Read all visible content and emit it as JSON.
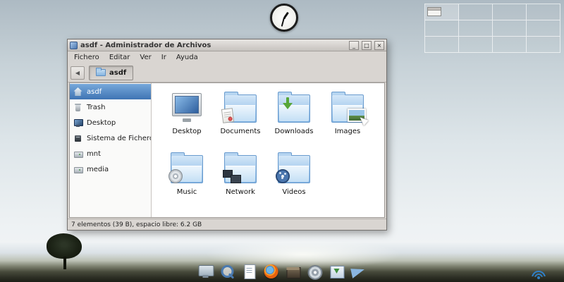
{
  "desktop": {
    "clock_widget": "analog-clock",
    "pager": {
      "columns": 4,
      "rows": 3,
      "active_workspace": 1
    }
  },
  "window": {
    "title": "asdf - Administrador de Archivos",
    "buttons": {
      "minimize": "_",
      "maximize": "□",
      "close": "×"
    },
    "menu": [
      {
        "label": "Fichero"
      },
      {
        "label": "Editar"
      },
      {
        "label": "Ver"
      },
      {
        "label": "Ir"
      },
      {
        "label": "Ayuda"
      }
    ],
    "toolbar": {
      "back_icon": "◀",
      "path_button": {
        "label": "asdf"
      }
    },
    "sidebar": {
      "items": [
        {
          "label": "asdf",
          "icon": "home-icon",
          "selected": true
        },
        {
          "label": "Trash",
          "icon": "trash-icon",
          "selected": false
        },
        {
          "label": "Desktop",
          "icon": "monitor-icon",
          "selected": false
        },
        {
          "label": "Sistema de Ficheros",
          "icon": "computer-icon",
          "selected": false
        },
        {
          "label": "mnt",
          "icon": "drive-icon",
          "selected": false
        },
        {
          "label": "media",
          "icon": "drive-icon",
          "selected": false
        }
      ]
    },
    "files": {
      "items": [
        {
          "label": "Desktop",
          "icon": "desktop-monitor-icon"
        },
        {
          "label": "Documents",
          "icon": "documents-folder-icon"
        },
        {
          "label": "Downloads",
          "icon": "downloads-folder-icon"
        },
        {
          "label": "Images",
          "icon": "images-folder-icon"
        },
        {
          "label": "Music",
          "icon": "music-folder-icon"
        },
        {
          "label": "Network",
          "icon": "network-folder-icon"
        },
        {
          "label": "Videos",
          "icon": "videos-folder-icon"
        }
      ]
    },
    "statusbar": "7 elementos (39 B), espacio libre: 6.2 GB"
  },
  "dock": {
    "items": [
      {
        "icon": "display-icon"
      },
      {
        "icon": "search-icon"
      },
      {
        "icon": "document-icon"
      },
      {
        "icon": "firefox-icon"
      },
      {
        "icon": "package-icon"
      },
      {
        "icon": "disc-icon"
      },
      {
        "icon": "installer-icon"
      },
      {
        "icon": "send-icon"
      }
    ]
  },
  "tray": {
    "wifi": "wifi-icon"
  }
}
